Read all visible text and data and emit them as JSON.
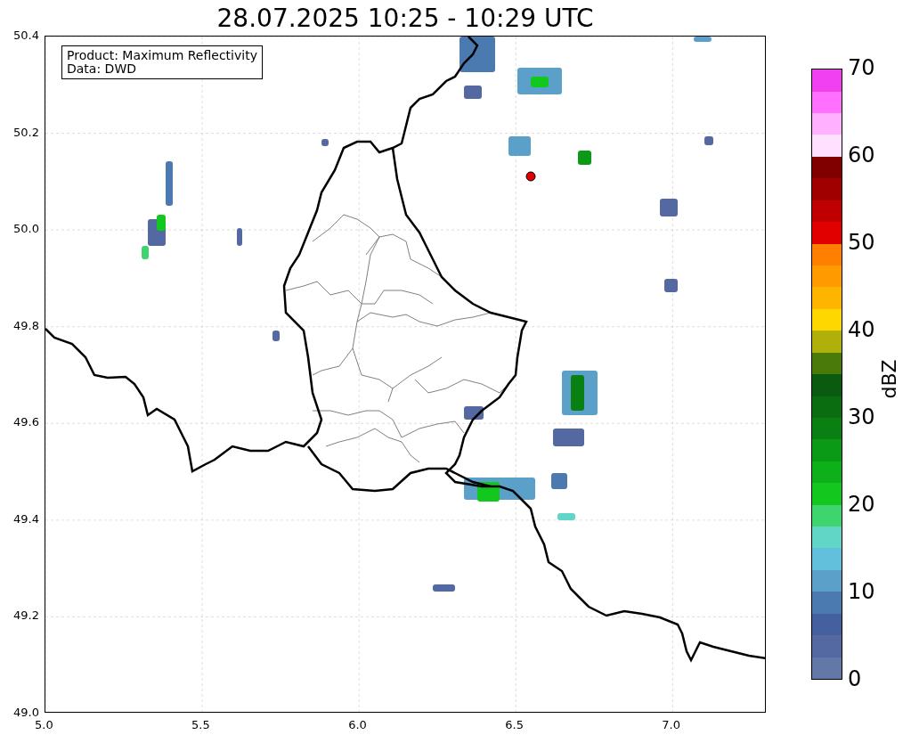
{
  "title": "28.07.2025 10:25 - 10:29 UTC",
  "info_box": {
    "lines": [
      "Product: Maximum Reflectivity",
      "Data: DWD"
    ]
  },
  "x_ticks": [
    "5.0",
    "5.5",
    "6.0",
    "6.5",
    "7.0"
  ],
  "y_ticks": [
    "50.4",
    "50.2",
    "50.0",
    "49.8",
    "49.6",
    "49.4",
    "49.2",
    "49.0"
  ],
  "colorbar": {
    "label": "dBZ",
    "ticks": [
      "70",
      "60",
      "50",
      "40",
      "30",
      "20",
      "10",
      "0"
    ],
    "segments": [
      {
        "color": "#6478a8"
      },
      {
        "color": "#5468a2"
      },
      {
        "color": "#44609e"
      },
      {
        "color": "#4a7ab0"
      },
      {
        "color": "#5aa0c8"
      },
      {
        "color": "#62c0dc"
      },
      {
        "color": "#62d6c6"
      },
      {
        "color": "#3ed46e"
      },
      {
        "color": "#12c81e"
      },
      {
        "color": "#0eb01a"
      },
      {
        "color": "#0a9a16"
      },
      {
        "color": "#0a8012"
      },
      {
        "color": "#0a6e10"
      },
      {
        "color": "#0a5a10"
      },
      {
        "color": "#4a7a0a"
      },
      {
        "color": "#b0b00a"
      },
      {
        "color": "#ffd700"
      },
      {
        "color": "#ffb400"
      },
      {
        "color": "#ff9a00"
      },
      {
        "color": "#ff8000"
      },
      {
        "color": "#e00000"
      },
      {
        "color": "#c00000"
      },
      {
        "color": "#a00000"
      },
      {
        "color": "#800000"
      },
      {
        "color": "#ffe0ff"
      },
      {
        "color": "#ffb0ff"
      },
      {
        "color": "#ff70ff"
      },
      {
        "color": "#f040f0"
      }
    ]
  }
}
